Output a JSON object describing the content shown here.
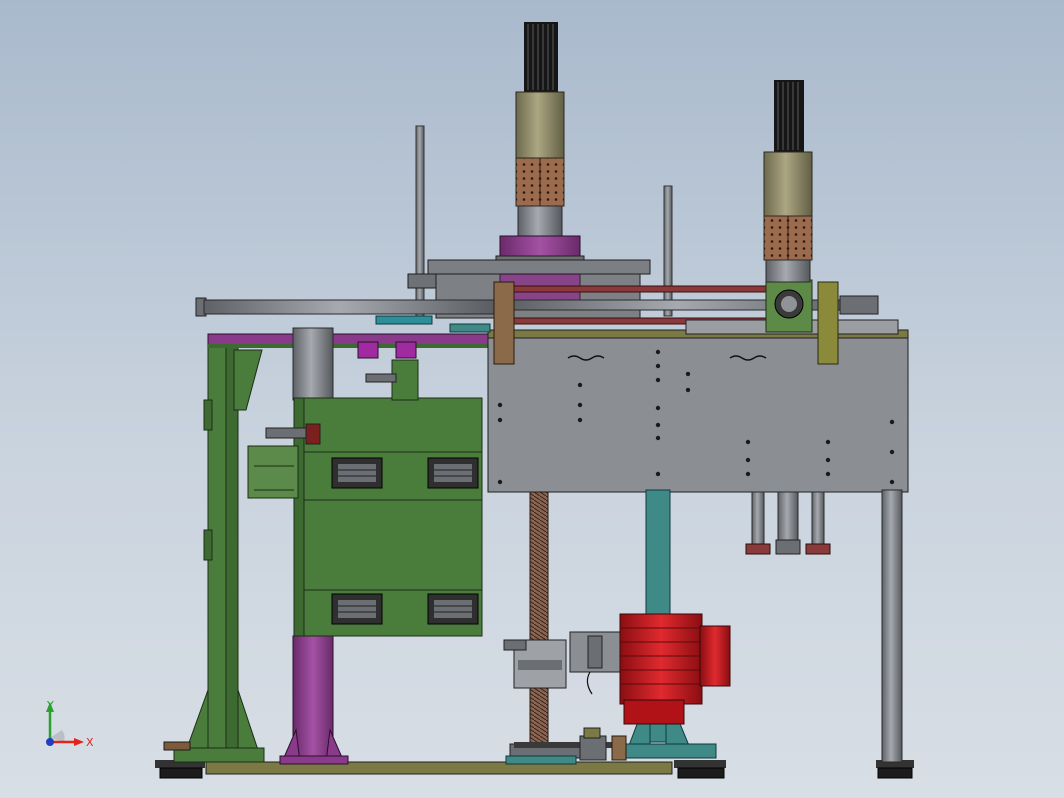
{
  "viewport": {
    "background_top": "#a9b9cc",
    "background_bottom": "#d8dee5"
  },
  "triad": {
    "x_label": "X",
    "y_label": "Y",
    "x_color": "#e2231a",
    "y_color": "#2ca02c",
    "z_color": "#1f3fbf"
  },
  "model": {
    "description_colors": {
      "frame_green": "#4a7c3c",
      "carriage_gray": "#7b7f84",
      "motor_red": "#c8141c",
      "column_purple": "#8a3a8a",
      "column_teal": "#3f8a86",
      "tool_khaki": "#8f8a6a",
      "plate_olive": "#8b8a3a"
    }
  }
}
